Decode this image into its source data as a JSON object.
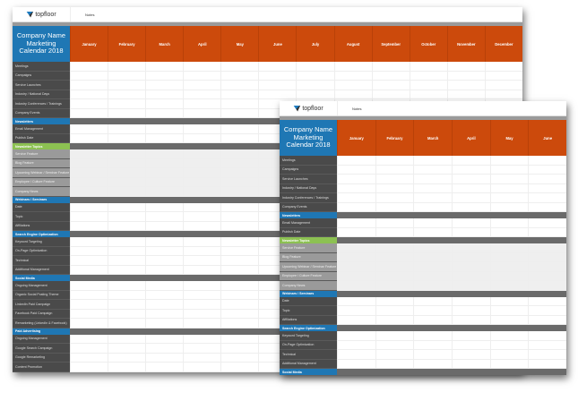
{
  "logo": "topfloor",
  "notes_label": "Notes",
  "title": "Company Name Marketing Calendar 2018",
  "months": [
    "January",
    "February",
    "March",
    "April",
    "May",
    "June",
    "July",
    "August",
    "September",
    "October",
    "November",
    "December"
  ],
  "front_months": [
    "January",
    "February",
    "March",
    "April",
    "May",
    "June"
  ],
  "colors": {
    "title": "#1f77b4",
    "months": "#cc4a0c",
    "section_blue": "#1f77b4",
    "section_green": "#8cc152"
  },
  "sections": [
    {
      "title": null,
      "rows": [
        "Meetings",
        "Campaigns",
        "Service Launches",
        "Industry / National Days",
        "Industry Conferences / Trainings",
        "Company Events"
      ]
    },
    {
      "title": "Newsletters",
      "color": "#1f77b4",
      "rows": [
        "Email Management",
        "Publish Date"
      ]
    },
    {
      "title": "Newsletter Topics",
      "color": "#8cc152",
      "light": true,
      "rows": [
        "Service Feature",
        "Blog Feature",
        "Upcoming Webinar / Seminar Feature",
        "Employee / Culture Feature",
        "Company News"
      ]
    },
    {
      "title": "Webinars / Seminars",
      "color": "#1f77b4",
      "rows": [
        "Date",
        "Topic",
        "Affiliations"
      ]
    },
    {
      "title": "Search Engine Optimization",
      "color": "#1f77b4",
      "rows": [
        "Keyword Targeting",
        "On-Page Optimization",
        "Technical",
        "Additional Management"
      ]
    },
    {
      "title": "Social Media",
      "color": "#1f77b4",
      "rows": [
        "Ongoing Management",
        "Organic Social Posting Theme",
        "LinkedIn Paid Campaign",
        "Facebook Paid Campaign",
        "Remarketing (LinkedIn & Facebook)"
      ]
    },
    {
      "title": "Paid Advertising",
      "color": "#1f77b4",
      "rows": [
        "Ongoing Management",
        "Google Search Campaign",
        "Google Remarketing",
        "Content Promotion"
      ]
    }
  ]
}
